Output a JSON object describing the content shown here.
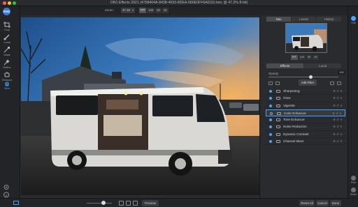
{
  "window": {
    "title": "ON1 Effects 2021 (4758404A-8438-4093-8DEA-060E0FF6AD1D.heic @ 47.2% 8-bit)"
  },
  "toolbar": {
    "zoom_label": "Zoom:",
    "zoom_value": "47.16",
    "zoom_buttons": [
      "FIT",
      "100",
      "50",
      "25"
    ],
    "zoom_active": "FIT"
  },
  "left_tools": [
    {
      "label": "Crop",
      "icon": "crop-icon"
    },
    {
      "label": "Local",
      "icon": "brush-icon"
    },
    {
      "label": "Mask",
      "icon": "mask-icon"
    },
    {
      "label": "Refine",
      "icon": "refine-icon"
    },
    {
      "label": "Retouch",
      "icon": "retouch-icon"
    },
    {
      "label": "View",
      "icon": "hand-icon"
    }
  ],
  "right_panel": {
    "tabs": [
      "Nav",
      "Levels",
      "History"
    ],
    "active_tab": "Nav",
    "thumb_zoom_buttons": [
      "FIT",
      "100",
      "50",
      "25"
    ],
    "subtabs": [
      "Effects",
      "Local"
    ],
    "active_subtab": "Effects",
    "opacity_label": "Opacity",
    "opacity_value": "100",
    "opacity_level": 1.0,
    "add_filter_label": "Add Filter",
    "filters": [
      {
        "name": "Sharpening",
        "selected": false
      },
      {
        "name": "Glow",
        "selected": false
      },
      {
        "name": "Vignette",
        "selected": false
      },
      {
        "name": "Color Enhancer",
        "selected": true
      },
      {
        "name": "Tone Enhancer",
        "selected": false
      },
      {
        "name": "Noise Reduction",
        "selected": false
      },
      {
        "name": "Dynamic Contrast",
        "selected": false
      },
      {
        "name": "Channel Mixer",
        "selected": false
      }
    ]
  },
  "right_bar": {
    "top_label": "Edit",
    "bottom_labels": [
      "Print",
      "Share"
    ]
  },
  "bottom_bar": {
    "preview_label": "Preview",
    "reset_all_label": "Reset All",
    "cancel_label": "Cancel",
    "done_label": "Done"
  },
  "colors": {
    "accent": "#4aa3ff",
    "panel": "#2a2b2e",
    "background": "#1c1d1f"
  }
}
